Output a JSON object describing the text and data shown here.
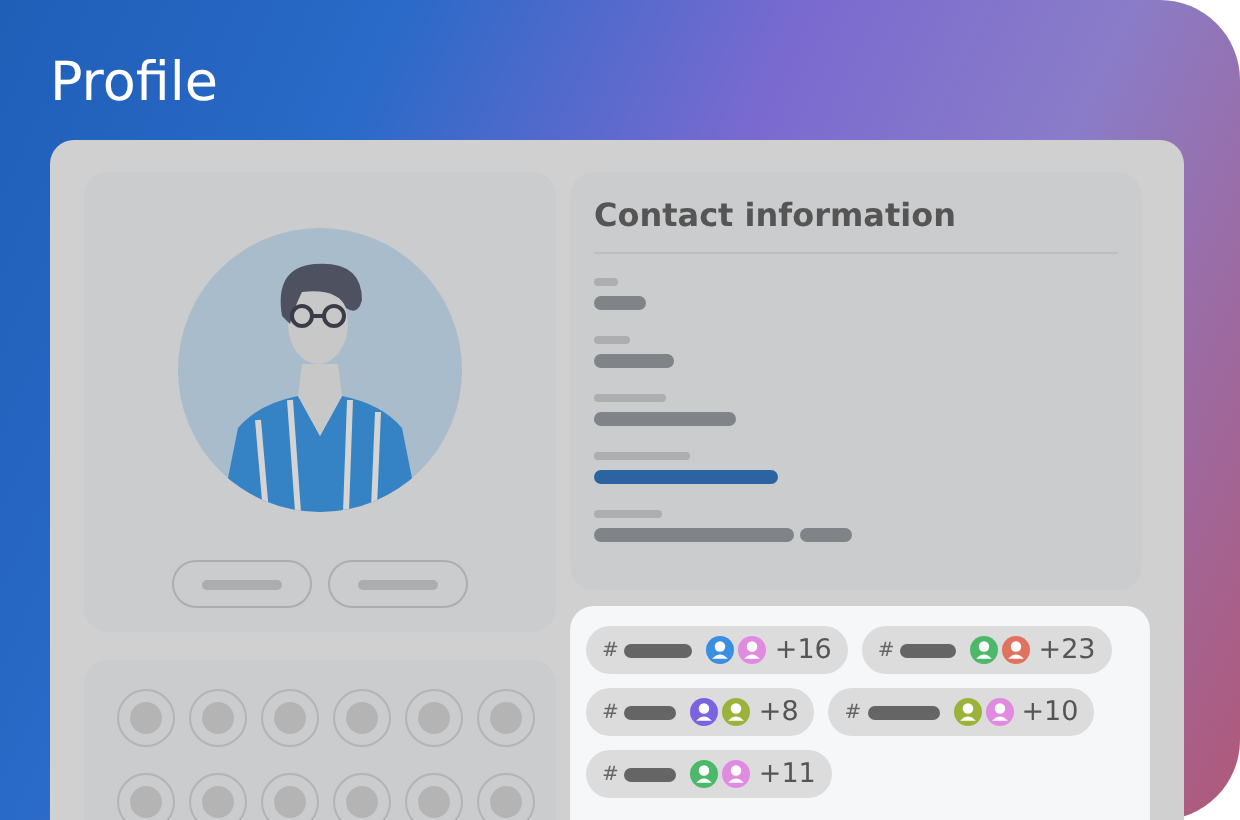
{
  "page": {
    "title": "Profile"
  },
  "profile_card": {
    "buttons": [
      {
        "selected": false
      },
      {
        "selected": false
      }
    ]
  },
  "contact": {
    "title": "Contact information",
    "fields": [
      {
        "selected": false
      },
      {
        "selected": false
      },
      {
        "selected": false
      },
      {
        "selected": true
      },
      {
        "selected": false
      }
    ]
  },
  "tags": [
    {
      "symbol": "#",
      "count": "+16",
      "members": [
        {
          "color": "#3a8fe0"
        },
        {
          "color": "#e08ae0"
        }
      ]
    },
    {
      "symbol": "#",
      "count": "+23",
      "members": [
        {
          "color": "#4cb86a"
        },
        {
          "color": "#e0725f"
        }
      ]
    },
    {
      "symbol": "#",
      "count": "+8",
      "members": [
        {
          "color": "#7a62e0"
        },
        {
          "color": "#9bb33a"
        }
      ]
    },
    {
      "symbol": "#",
      "count": "+10",
      "members": [
        {
          "color": "#9bb33a"
        },
        {
          "color": "#e08ae0"
        }
      ]
    },
    {
      "symbol": "#",
      "count": "+11",
      "members": [
        {
          "color": "#4cb86a"
        },
        {
          "color": "#e08ae0"
        }
      ]
    }
  ]
}
